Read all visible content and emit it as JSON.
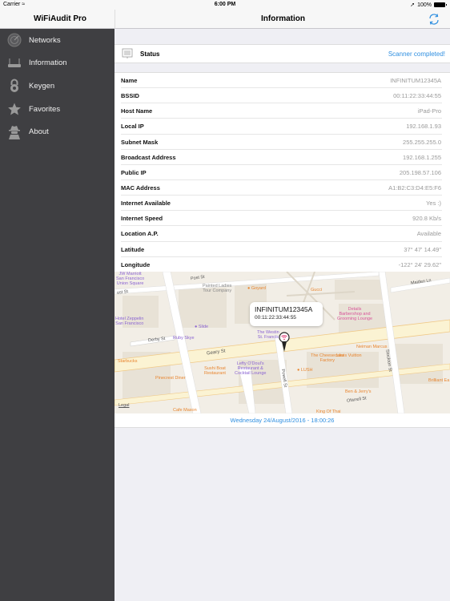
{
  "status_bar": {
    "carrier": "Carrier",
    "time": "6:00 PM",
    "battery": "100%"
  },
  "sidebar": {
    "title": "WiFiAudit Pro",
    "items": [
      {
        "label": "Networks",
        "icon": "radar-icon"
      },
      {
        "label": "Information",
        "icon": "router-icon"
      },
      {
        "label": "Keygen",
        "icon": "lock-icon"
      },
      {
        "label": "Favorites",
        "icon": "star-icon"
      },
      {
        "label": "About",
        "icon": "spy-icon"
      }
    ]
  },
  "header": {
    "title": "Information",
    "refresh_icon": "refresh-icon"
  },
  "status": {
    "label": "Status",
    "value": "Scanner completed!"
  },
  "info": [
    {
      "key": "Name",
      "value": "INFINITUM12345A"
    },
    {
      "key": "BSSID",
      "value": "00:11:22:33:44:55"
    },
    {
      "key": "Host Name",
      "value": "iPad-Pro"
    },
    {
      "key": "Local IP",
      "value": "192.168.1.93"
    },
    {
      "key": "Subnet Mask",
      "value": "255.255.255.0"
    },
    {
      "key": "Broadcast Address",
      "value": "192.168.1.255"
    },
    {
      "key": "Public IP",
      "value": "205.198.57.106"
    },
    {
      "key": "MAC Address",
      "value": "A1:B2:C3:D4:E5:F6"
    },
    {
      "key": "Internet Available",
      "value": "Yes :)"
    },
    {
      "key": "Internet Speed",
      "value": "920.8 Kb/s"
    },
    {
      "key": "Location A.P.",
      "value": "Available"
    },
    {
      "key": "Latitude",
      "value": "37° 47' 14.49\""
    },
    {
      "key": "Longitude",
      "value": "-122° 24' 29.62\""
    }
  ],
  "map": {
    "callout_title": "INFINITUM12345A",
    "callout_subtitle": "00:11:22:33:44:55",
    "legal": "Legal",
    "pois": [
      {
        "label": "JW Marriott\nSan Francisco\nUnion Square",
        "kind": "purple"
      },
      {
        "label": "Painted Ladies\nTour Company",
        "kind": "gray"
      },
      {
        "label": "Goyard",
        "kind": "orange"
      },
      {
        "label": "Hotel Zeppelin\nSan Francisco",
        "kind": "purple"
      },
      {
        "label": "Slide",
        "kind": "purple"
      },
      {
        "label": "Ruby Skye",
        "kind": "purple"
      },
      {
        "label": "The Westin\nSt. Francis",
        "kind": "purple"
      },
      {
        "label": "Starbucks",
        "kind": "orange"
      },
      {
        "label": "Sushi Boat\nRestaurant",
        "kind": "orange"
      },
      {
        "label": "Lefty O'Doul's\nRestaurant &\nCocktail Lounge",
        "kind": "purple"
      },
      {
        "label": "Pinecrest Diner",
        "kind": "orange"
      },
      {
        "label": "Cafe Mason",
        "kind": "orange"
      },
      {
        "label": "Gucci",
        "kind": "orange"
      },
      {
        "label": "Union Square",
        "kind": "gray"
      },
      {
        "label": "Details\nBarbershop and\nGrooming Lounge",
        "kind": "pink"
      },
      {
        "label": "Neiman Marcus",
        "kind": "orange"
      },
      {
        "label": "The Cheesecake\nFactory",
        "kind": "orange"
      },
      {
        "label": "Louis Vuitton",
        "kind": "orange"
      },
      {
        "label": "LUSH",
        "kind": "orange"
      },
      {
        "label": "Ben & Jerry's",
        "kind": "orange"
      },
      {
        "label": "Brilliant Earth",
        "kind": "orange"
      },
      {
        "label": "King Of Thai",
        "kind": "orange"
      }
    ],
    "streets": [
      "Post St",
      "Geary St",
      "Derby St",
      "Maiden Ln",
      "Stockton St",
      "Powell St",
      "Ofarrell St",
      "Ellis St"
    ]
  },
  "timestamp": "Wednesday 24/August/2016 - 18:00:26",
  "colors": {
    "accent": "#2f8fe0",
    "sidebar_bg": "#3f3f42",
    "background": "#efeff4"
  }
}
